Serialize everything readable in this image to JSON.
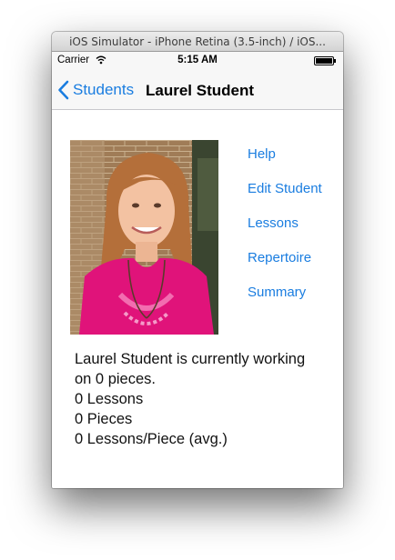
{
  "window": {
    "title": "iOS Simulator - iPhone Retina (3.5-inch) / iOS..."
  },
  "status_bar": {
    "carrier": "Carrier",
    "time": "5:15 AM"
  },
  "nav": {
    "back_label": "Students",
    "title": "Laurel Student"
  },
  "menu": {
    "items": [
      {
        "label": "Help"
      },
      {
        "label": "Edit Student"
      },
      {
        "label": "Lessons"
      },
      {
        "label": "Repertoire"
      },
      {
        "label": "Summary"
      }
    ]
  },
  "summary": {
    "line1": "Laurel Student is currently working",
    "line2": "on 0 pieces.",
    "line3": "0 Lessons",
    "line4": "0 Pieces",
    "line5": "0 Lessons/Piece (avg.)"
  },
  "colors": {
    "accent": "#1a7de0",
    "photo_shirt": "#e0137a"
  }
}
